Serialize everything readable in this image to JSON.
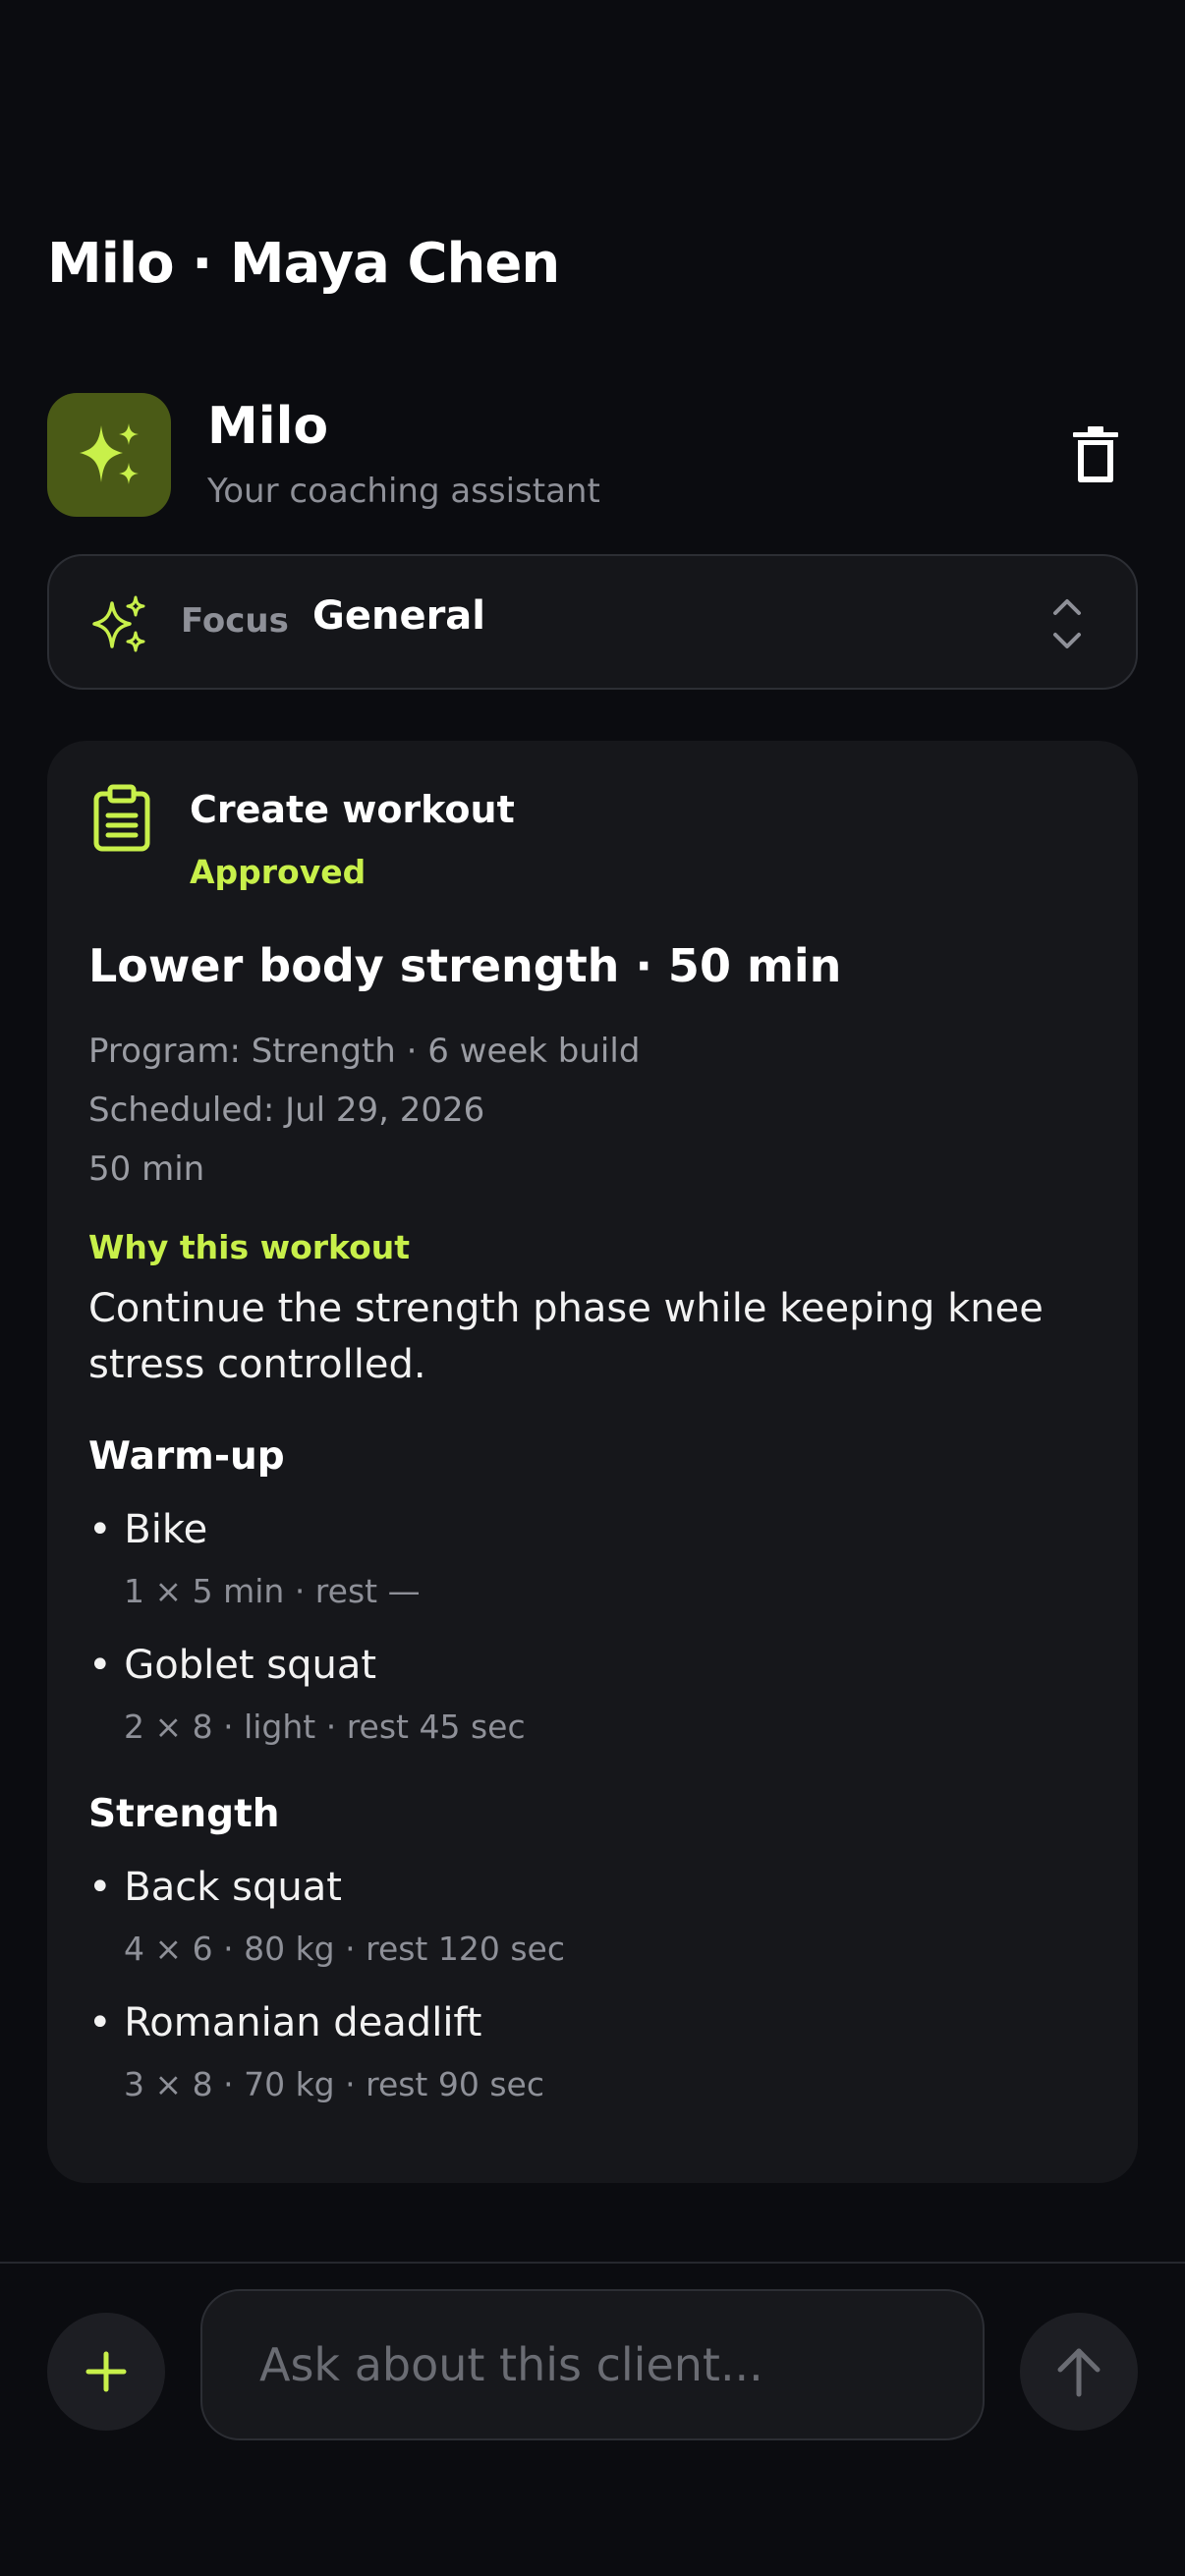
{
  "header": {
    "title": "Milo · Maya Chen"
  },
  "assistant": {
    "name": "Milo",
    "subtitle": "Your coaching assistant"
  },
  "focus": {
    "label": "Focus",
    "value": "General"
  },
  "workout_card": {
    "title": "Create workout",
    "status": "Approved",
    "workout_name": "Lower body strength · 50 min",
    "program": "Program: Strength · 6 week build",
    "scheduled": "Scheduled: Jul 29, 2026",
    "duration": "50 min",
    "why_label": "Why this workout",
    "why_text": "Continue the strength phase while keeping knee stress controlled.",
    "sections": [
      {
        "title": "Warm-up",
        "exercises": [
          {
            "name": "• Bike",
            "detail": "1 × 5 min · rest —"
          },
          {
            "name": "• Goblet squat",
            "detail": "2 × 8 · light · rest 45 sec"
          }
        ]
      },
      {
        "title": "Strength",
        "exercises": [
          {
            "name": "• Back squat",
            "detail": "4 × 6 · 80 kg · rest 120 sec"
          },
          {
            "name": "• Romanian deadlift",
            "detail": "3 × 8 · 70 kg · rest 90 sec"
          }
        ]
      }
    ]
  },
  "composer": {
    "placeholder": "Ask about this client..."
  },
  "colors": {
    "accent": "#c8f04a",
    "avatar_bg": "#4a5a16",
    "background": "#0b0c10",
    "card": "#16171b"
  },
  "icons": {
    "avatar": "sparkles-icon",
    "delete": "trash-icon",
    "focus": "sparkles-icon",
    "selector": "chevron-up-down-icon",
    "card": "clipboard-icon",
    "add": "plus-icon",
    "send": "arrow-up-icon"
  }
}
